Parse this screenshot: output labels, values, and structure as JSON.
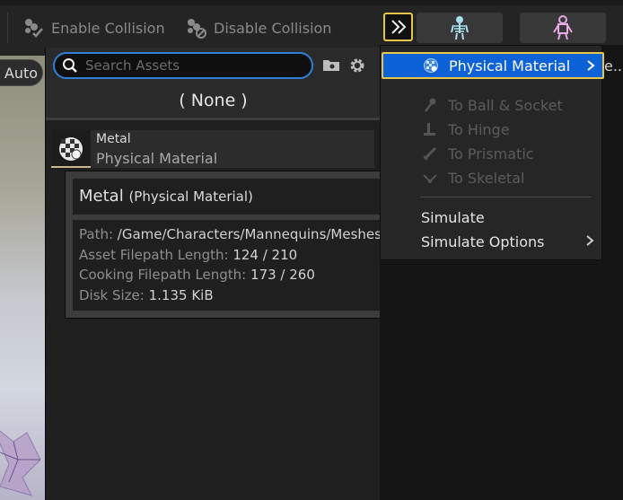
{
  "toolbar": {
    "enable_collision": "Enable Collision",
    "disable_collision": "Disable Collision"
  },
  "viewport": {
    "auto_label": "Auto"
  },
  "picker": {
    "search_placeholder": "Search Assets",
    "none_label": "( None )",
    "asset": {
      "name": "Metal",
      "type": "Physical Material"
    }
  },
  "tooltip": {
    "title": "Metal",
    "title_type": "(Physical Material)",
    "path_key": "Path:",
    "path_val": "/Game/Characters/Mannequins/Meshes",
    "asset_len_key": "Asset Filepath Length:",
    "asset_len_val": "124 / 210",
    "cook_len_key": "Cooking Filepath Length:",
    "cook_len_val": "173 / 260",
    "disk_key": "Disk Size:",
    "disk_val": "1.135 KiB"
  },
  "menu": {
    "selected": "Physical Material",
    "trailing_fragment": "e...",
    "items": [
      {
        "label": "To Ball & Socket",
        "icon": "ball-socket-icon",
        "enabled": false
      },
      {
        "label": "To Hinge",
        "icon": "hinge-icon",
        "enabled": false
      },
      {
        "label": "To Prismatic",
        "icon": "prismatic-icon",
        "enabled": false
      },
      {
        "label": "To Skeletal",
        "icon": "skeletal-icon",
        "enabled": false
      }
    ],
    "simulate": "Simulate",
    "simulate_options": "Simulate Options"
  },
  "colors": {
    "accent_blue": "#0e62d8",
    "focus_yellow": "#e6c54a",
    "search_border": "#2f7fd8"
  }
}
